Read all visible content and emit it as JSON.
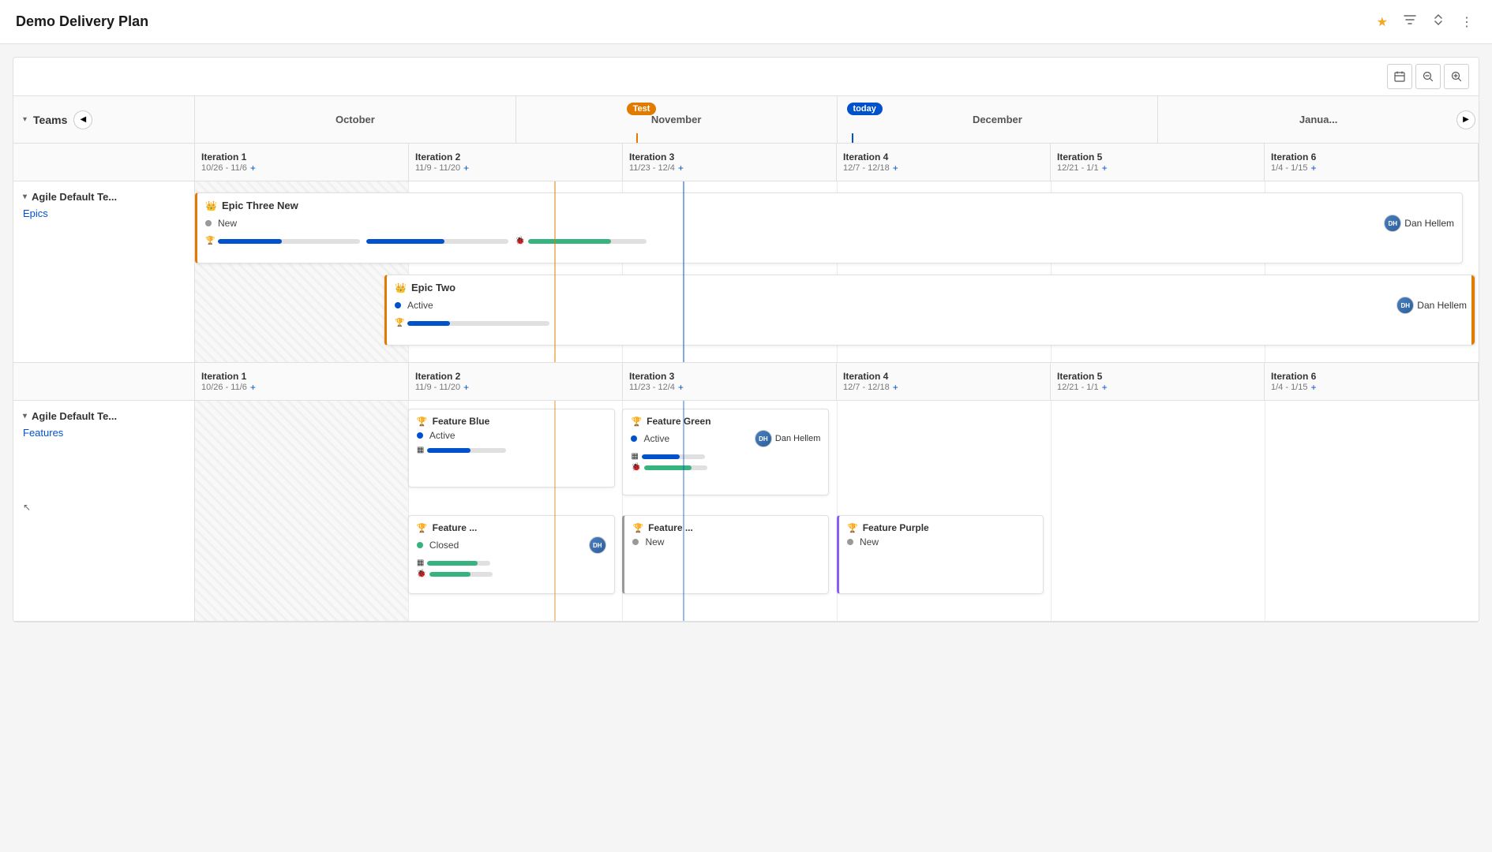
{
  "header": {
    "title": "Demo Delivery Plan"
  },
  "toolbar": {
    "calendar_label": "Calendar",
    "zoom_out_label": "Zoom out",
    "zoom_in_label": "Zoom in"
  },
  "timeline": {
    "months": [
      "October",
      "November",
      "December",
      "Janua..."
    ],
    "today_label": "today",
    "test_label": "Test",
    "teams_label": "Teams"
  },
  "team1": {
    "name": "Agile Default Te...",
    "type": "Epics",
    "iterations": [
      {
        "name": "Iteration 1",
        "dates": "10/26 - 11/6"
      },
      {
        "name": "Iteration 2",
        "dates": "11/9 - 11/20"
      },
      {
        "name": "Iteration 3",
        "dates": "11/23 - 12/4"
      },
      {
        "name": "Iteration 4",
        "dates": "12/7 - 12/18"
      },
      {
        "name": "Iteration 5",
        "dates": "12/21 - 1/1"
      },
      {
        "name": "Iteration 6",
        "dates": "1/4 - 1/15"
      }
    ],
    "epics": [
      {
        "title": "Epic Three New",
        "status": "New",
        "status_type": "gray",
        "assignee": "Dan Hellem",
        "has_avatar": true
      },
      {
        "title": "Epic Two",
        "status": "Active",
        "status_type": "blue",
        "assignee": "Dan Hellem",
        "has_avatar": true
      }
    ]
  },
  "team2": {
    "name": "Agile Default Te...",
    "type": "Features",
    "iterations": [
      {
        "name": "Iteration 1",
        "dates": "10/26 - 11/6"
      },
      {
        "name": "Iteration 2",
        "dates": "11/9 - 11/20"
      },
      {
        "name": "Iteration 3",
        "dates": "11/23 - 12/4"
      },
      {
        "name": "Iteration 4",
        "dates": "12/7 - 12/18"
      },
      {
        "name": "Iteration 5",
        "dates": "12/21 - 1/1"
      },
      {
        "name": "Iteration 6",
        "dates": "1/4 - 1/15"
      }
    ],
    "features": [
      {
        "id": "feature-blue",
        "title": "Feature Blue",
        "status": "Active",
        "status_type": "blue",
        "col": 1,
        "row": 0
      },
      {
        "id": "feature-green",
        "title": "Feature Green",
        "status": "Active",
        "status_type": "blue",
        "assignee": "Dan Hellem",
        "has_avatar": true,
        "col": 2,
        "row": 0
      },
      {
        "id": "feature-yellow",
        "title": "Feature ...",
        "status": "Closed",
        "status_type": "green",
        "col": 1,
        "row": 1
      },
      {
        "id": "feature-gray",
        "title": "Feature ...",
        "status": "New",
        "status_type": "gray",
        "col": 2,
        "row": 1
      },
      {
        "id": "feature-purple",
        "title": "Feature Purple",
        "status": "New",
        "status_type": "gray",
        "col": 3,
        "row": 1
      }
    ]
  }
}
